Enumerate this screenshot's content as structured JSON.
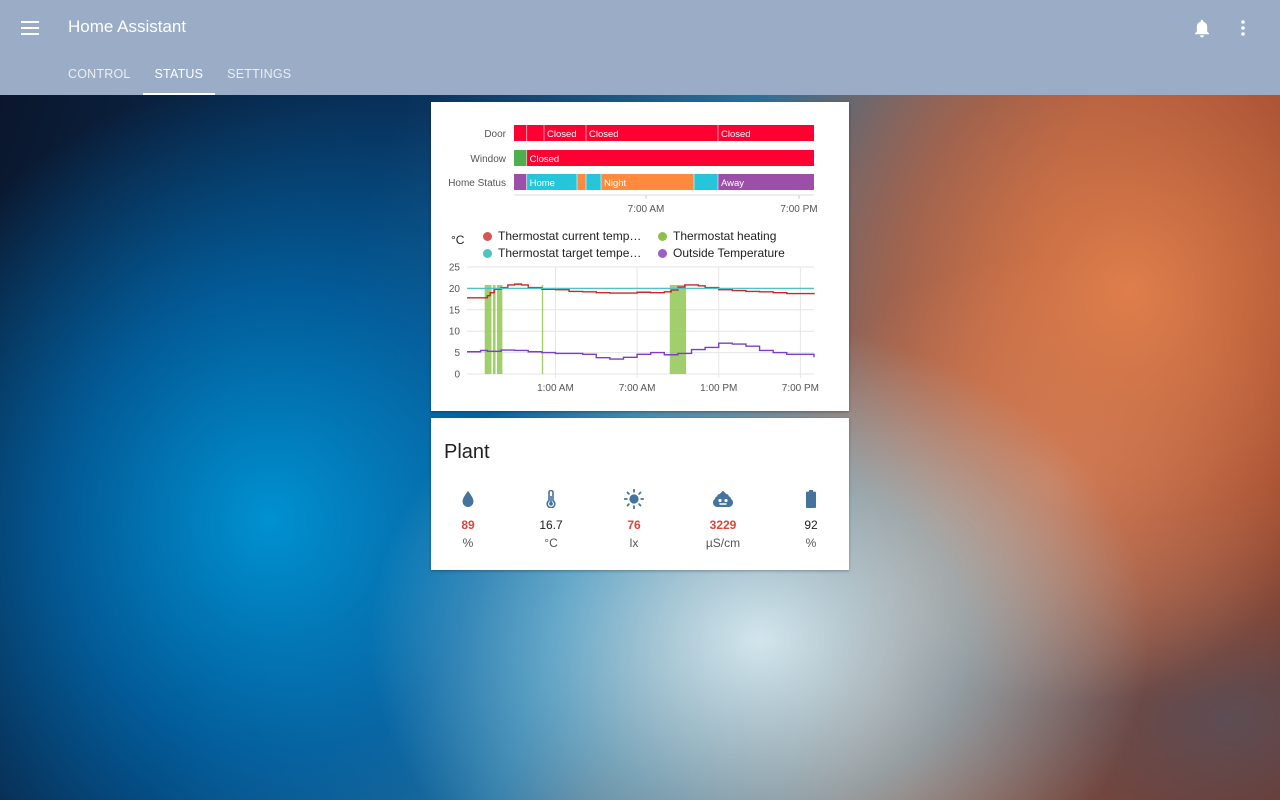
{
  "header": {
    "title": "Home Assistant",
    "tabs": [
      {
        "label": "CONTROL",
        "active": false
      },
      {
        "label": "STATUS",
        "active": true
      },
      {
        "label": "SETTINGS",
        "active": false
      }
    ],
    "icons": {
      "menu": "menu-icon",
      "notifications": "bell-icon",
      "more": "more-vert-icon"
    }
  },
  "timeline": {
    "rows": [
      {
        "label": "Door",
        "segments": [
          {
            "from": 0.0,
            "to": 0.042,
            "state": "",
            "color": "#ff0033"
          },
          {
            "from": 0.042,
            "to": 0.1,
            "state": "",
            "color": "#ff0033"
          },
          {
            "from": 0.1,
            "to": 0.24,
            "state": "Closed",
            "color": "#ff0033"
          },
          {
            "from": 0.24,
            "to": 0.68,
            "state": "Closed",
            "color": "#ff0033"
          },
          {
            "from": 0.68,
            "to": 1.0,
            "state": "Closed",
            "color": "#ff0033"
          }
        ]
      },
      {
        "label": "Window",
        "segments": [
          {
            "from": 0.0,
            "to": 0.042,
            "state": "",
            "color": "#4caf50"
          },
          {
            "from": 0.042,
            "to": 1.0,
            "state": "Closed",
            "color": "#ff0033"
          }
        ]
      },
      {
        "label": "Home Status",
        "segments": [
          {
            "from": 0.0,
            "to": 0.042,
            "state": "",
            "color": "#9c4fa9"
          },
          {
            "from": 0.042,
            "to": 0.21,
            "state": "Home",
            "color": "#26c6da"
          },
          {
            "from": 0.21,
            "to": 0.24,
            "state": "",
            "color": "#ff8a3d"
          },
          {
            "from": 0.24,
            "to": 0.29,
            "state": "",
            "color": "#26c6da"
          },
          {
            "from": 0.29,
            "to": 0.6,
            "state": "Night",
            "color": "#ff8a3d"
          },
          {
            "from": 0.6,
            "to": 0.68,
            "state": "",
            "color": "#26c6da"
          },
          {
            "from": 0.68,
            "to": 1.0,
            "state": "Away",
            "color": "#9c4fa9"
          }
        ]
      }
    ],
    "ticks": [
      {
        "pos": 0.44,
        "label": "7:00 AM"
      },
      {
        "pos": 0.95,
        "label": "7:00 PM"
      }
    ]
  },
  "chart": {
    "unit": "°C",
    "legend": [
      {
        "name": "Thermostat current temp…",
        "color": "#d9534f"
      },
      {
        "name": "Thermostat heating",
        "color": "#8bc34a"
      },
      {
        "name": "Thermostat target tempe…",
        "color": "#4fc3c3"
      },
      {
        "name": "Outside Temperature",
        "color": "#9c5fc7"
      }
    ]
  },
  "chart_data": {
    "type": "line",
    "ylabel": "°C",
    "ylim": [
      0,
      25
    ],
    "yticks": [
      0,
      5,
      10,
      15,
      20,
      25
    ],
    "xticks": [
      {
        "label": "1:00 AM",
        "x": 6
      },
      {
        "label": "7:00 AM",
        "x": 12
      },
      {
        "label": "1:00 PM",
        "x": 18
      },
      {
        "label": "7:00 PM",
        "x": 24
      }
    ],
    "xlim": [
      -0.5,
      25
    ],
    "series": [
      {
        "name": "Thermostat current temp…",
        "color": "#c62828",
        "x": [
          -0.5,
          0.5,
          1.0,
          1.2,
          1.5,
          2.0,
          2.5,
          3.0,
          3.5,
          4.0,
          5.0,
          6.0,
          7.0,
          8.0,
          9.0,
          10.0,
          11.0,
          12.0,
          13.0,
          14.0,
          14.5,
          15.0,
          15.5,
          16.0,
          16.5,
          17.0,
          18.0,
          19.0,
          20.0,
          21.0,
          22.0,
          23.0,
          24.0,
          25.0
        ],
        "y": [
          17.8,
          17.8,
          18.3,
          19.0,
          19.8,
          20.2,
          20.8,
          21.0,
          20.8,
          20.2,
          19.8,
          19.7,
          19.3,
          19.2,
          19.0,
          18.9,
          18.9,
          19.1,
          19.0,
          19.2,
          19.6,
          20.3,
          20.8,
          20.8,
          20.6,
          20.2,
          19.7,
          19.5,
          19.3,
          19.2,
          19.0,
          18.8,
          18.8,
          18.6
        ]
      },
      {
        "name": "Thermostat target tempe…",
        "color": "#4fc3c3",
        "x": [
          -0.5,
          25
        ],
        "y": [
          20,
          20
        ]
      },
      {
        "name": "Outside Temperature",
        "color": "#7b3fc4",
        "x": [
          -0.5,
          0.5,
          1.0,
          2.0,
          3.0,
          4.0,
          5.0,
          6.0,
          7.0,
          8.0,
          9.0,
          10.0,
          11.0,
          12.0,
          13.0,
          14.0,
          15.0,
          16.0,
          17.0,
          18.0,
          19.0,
          20.0,
          21.0,
          22.0,
          23.0,
          24.0,
          25.0
        ],
        "y": [
          5.2,
          5.5,
          5.3,
          5.6,
          5.5,
          5.2,
          5.0,
          4.8,
          4.8,
          4.6,
          3.8,
          3.5,
          3.9,
          4.6,
          5.0,
          4.5,
          4.8,
          5.7,
          6.2,
          7.2,
          7.0,
          6.5,
          5.5,
          5.0,
          4.6,
          4.6,
          3.9
        ]
      }
    ],
    "heating_periods": [
      [
        0.8,
        1.3
      ],
      [
        1.4,
        1.6
      ],
      [
        1.7,
        2.1
      ],
      [
        5.0,
        5.1
      ],
      [
        14.4,
        15.6
      ]
    ]
  },
  "plant": {
    "title": "Plant",
    "attributes": [
      {
        "icon": "water-drop-icon",
        "value": "89",
        "unit": "%",
        "alert": true
      },
      {
        "icon": "thermometer-icon",
        "value": "16.7",
        "unit": "°C",
        "alert": false
      },
      {
        "icon": "sun-icon",
        "value": "76",
        "unit": "lx",
        "alert": true
      },
      {
        "icon": "fertilizer-icon",
        "value": "3229",
        "unit": "µS/cm",
        "alert": true
      },
      {
        "icon": "battery-icon",
        "value": "92",
        "unit": "%",
        "alert": false
      }
    ]
  }
}
